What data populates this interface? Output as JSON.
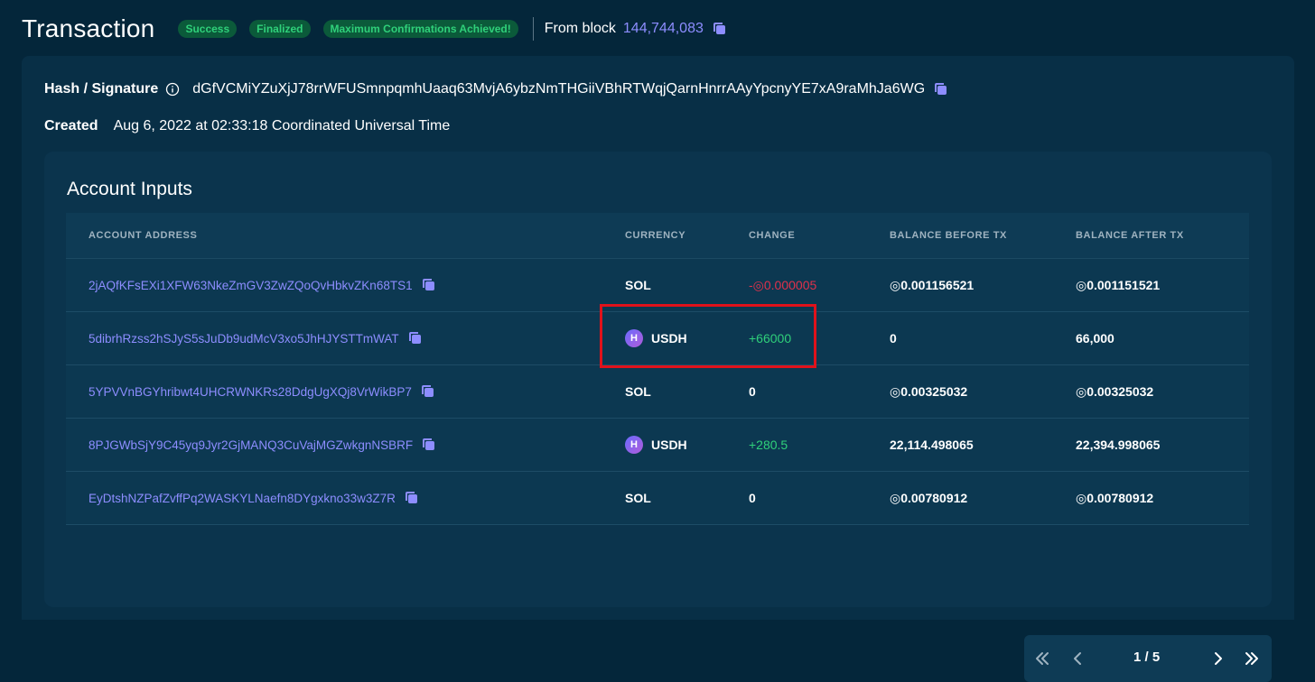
{
  "header": {
    "title": "Transaction",
    "badges": [
      "Success",
      "Finalized",
      "Maximum Confirmations Achieved!"
    ],
    "from_block_label": "From block",
    "block_number": "144,744,083"
  },
  "meta": {
    "hash_label": "Hash / Signature",
    "hash_value": "dGfVCMiYZuXjJ78rrWFUSmnpqmhUaaq63MvjA6ybzNmTHGiiVBhRTWqjQarnHnrrAAyYpcnyYE7xA9raMhJa6WG",
    "created_label": "Created",
    "created_value": "Aug 6, 2022 at 02:33:18 Coordinated Universal Time"
  },
  "inputs": {
    "title": "Account Inputs",
    "columns": [
      "ACCOUNT ADDRESS",
      "CURRENCY",
      "CHANGE",
      "BALANCE BEFORE TX",
      "BALANCE AFTER TX"
    ],
    "rows": [
      {
        "address": "2jAQfKFsEXi1XFW63NkeZmGV3ZwZQoQvHbkvZKn68TS1",
        "currency": "SOL",
        "token_icon": "",
        "change": "-◎0.000005",
        "change_type": "neg",
        "before": "◎0.001156521",
        "after": "◎0.001151521"
      },
      {
        "address": "5dibrhRzss2hSJyS5sJuDb9udMcV3xo5JhHJYSTTmWAT",
        "currency": "USDH",
        "token_icon": "H",
        "change": "+66000",
        "change_type": "pos",
        "before": "0",
        "after": "66,000"
      },
      {
        "address": "5YPVVnBGYhribwt4UHCRWNKRs28DdgUgXQj8VrWikBP7",
        "currency": "SOL",
        "token_icon": "",
        "change": "0",
        "change_type": "zero",
        "before": "◎0.00325032",
        "after": "◎0.00325032"
      },
      {
        "address": "8PJGWbSjY9C45yq9Jyr2GjMANQ3CuVajMGZwkgnNSBRF",
        "currency": "USDH",
        "token_icon": "H",
        "change": "+280.5",
        "change_type": "pos",
        "before": "22,114.498065",
        "after": "22,394.998065"
      },
      {
        "address": "EyDtshNZPafZvffPq2WASKYLNaefn8DYgxkno33w3Z7R",
        "currency": "SOL",
        "token_icon": "",
        "change": "0",
        "change_type": "zero",
        "before": "◎0.00780912",
        "after": "◎0.00780912"
      }
    ]
  },
  "pagination": {
    "label": "1 / 5",
    "icons": [
      "double-chevron-left-icon",
      "chevron-left-icon",
      "chevron-right-icon",
      "double-chevron-right-icon"
    ]
  },
  "colors": {
    "background": "#04263a",
    "link": "#8d8dff",
    "positive": "#2fd07a",
    "negative": "#e0314b",
    "highlight_box": "#e0121b"
  }
}
